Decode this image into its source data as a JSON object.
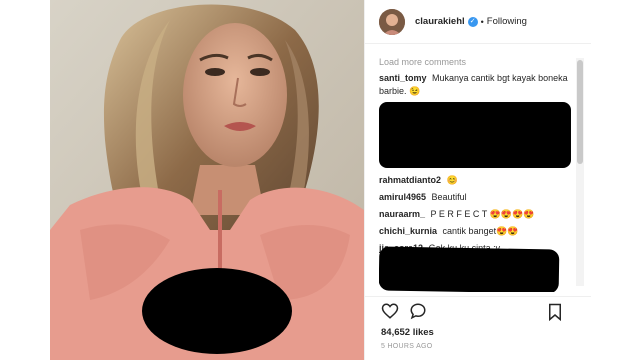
{
  "header": {
    "username": "claurakiehl",
    "follow_status": "Following",
    "separator": "•"
  },
  "comments": {
    "load_more": "Load more comments",
    "items": [
      {
        "user": "santi_tomy",
        "text": "Mukanya cantik bgt kayak boneka barbie. 😉"
      },
      {
        "user": "rahmatdianto2",
        "text": "😊"
      },
      {
        "user": "amirul4965",
        "text": "Beautiful"
      },
      {
        "user": "nauraarm_",
        "text": "P E R F E C T 😍😍😍😍"
      },
      {
        "user": "chichi_kurnia",
        "text": "cantik banget😍😍"
      },
      {
        "user": "jje_core12",
        "text": "Gak ku ku cinta :v"
      }
    ]
  },
  "post": {
    "likes": "84,652 likes",
    "time": "5 HOURS AGO"
  },
  "icons": [
    "heart-icon",
    "comment-icon",
    "bookmark-icon",
    "verified-badge-icon"
  ],
  "colors": {
    "verified": "#3897f0",
    "redaction": "#000000",
    "dress": "#e79c8e"
  }
}
